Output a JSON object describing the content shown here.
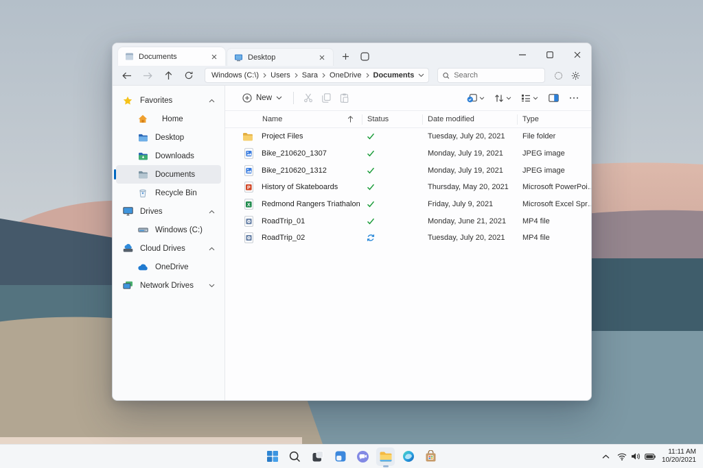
{
  "colors": {
    "accent": "#0067C0",
    "synced_check_green": "#1B9C3A",
    "syncing_blue": "#2586D8",
    "folder_yellow": "#F2C04E",
    "selection_bar_blue": "#0067C0"
  },
  "window": {
    "tabs": [
      {
        "label": "Documents",
        "state": "active"
      },
      {
        "label": "Desktop",
        "state": "inactive"
      }
    ],
    "address": {
      "segments": [
        "Windows (C:\\)",
        "Users",
        "Sara",
        "OneDrive",
        "Documents"
      ]
    },
    "search": {
      "placeholder": "Search"
    },
    "toolbar": {
      "new_label": "New"
    },
    "list": {
      "columns": [
        "Name",
        "Status",
        "Date modified",
        "Type"
      ],
      "sort": {
        "column": "Name",
        "direction": "ascending"
      },
      "rows": [
        {
          "name": "Project Files",
          "status": "synced",
          "date": "Tuesday, July 20, 2021",
          "type": "File folder"
        },
        {
          "name": "Bike_210620_1307",
          "status": "synced",
          "date": "Monday, July 19, 2021",
          "type": "JPEG image"
        },
        {
          "name": "Bike_210620_1312",
          "status": "synced",
          "date": "Monday, July 19, 2021",
          "type": "JPEG image"
        },
        {
          "name": "History of Skateboards",
          "status": "synced",
          "date": "Thursday, May 20, 2021",
          "type": "Microsoft PowerPoi…"
        },
        {
          "name": "Redmond Rangers Triathalon",
          "status": "synced",
          "date": "Friday, July 9, 2021",
          "type": "Microsoft Excel Spr…"
        },
        {
          "name": "RoadTrip_01",
          "status": "synced",
          "date": "Monday, June 21, 2021",
          "type": "MP4 file"
        },
        {
          "name": "RoadTrip_02",
          "status": "syncing",
          "date": "Tuesday, July 20, 2021",
          "type": "MP4 file"
        }
      ]
    }
  },
  "sidebar": {
    "sections": [
      {
        "label": "Favorites",
        "expanded": true
      },
      {
        "label": "Drives",
        "expanded": true
      },
      {
        "label": "Cloud Drives",
        "expanded": true
      },
      {
        "label": "Network Drives",
        "expanded": false
      }
    ],
    "items": {
      "home": "Home",
      "desktop": "Desktop",
      "downloads": "Downloads",
      "documents": "Documents",
      "recycle_bin": "Recycle Bin",
      "windows_c": "Windows (C:)",
      "onedrive": "OneDrive"
    }
  },
  "taskbar": {
    "apps": [
      "start",
      "search",
      "task-view",
      "widgets",
      "chat",
      "file-explorer",
      "edge",
      "store"
    ],
    "active_app": "file-explorer",
    "clock": {
      "time": "11:11 AM",
      "date": "10/20/2021"
    }
  },
  "icons": [
    "star-icon",
    "home-icon",
    "folder-icon",
    "recycle-bin-icon",
    "monitor-icon",
    "hard-drive-icon",
    "cloud-drive-icon",
    "onedrive-cloud-icon",
    "network-drive-icon",
    "back-arrow-icon",
    "forward-arrow-icon",
    "up-arrow-icon",
    "refresh-icon",
    "search-icon",
    "sync-spinner-icon",
    "settings-gear-icon",
    "new-plus-icon",
    "cut-icon",
    "copy-icon",
    "paste-icon",
    "sync-options-icon",
    "sort-icon",
    "view-icon",
    "details-pane-icon",
    "more-icon",
    "check-icon",
    "sync-arrows-icon",
    "chevron-icon",
    "wifi-icon",
    "volume-icon",
    "battery-icon"
  ]
}
